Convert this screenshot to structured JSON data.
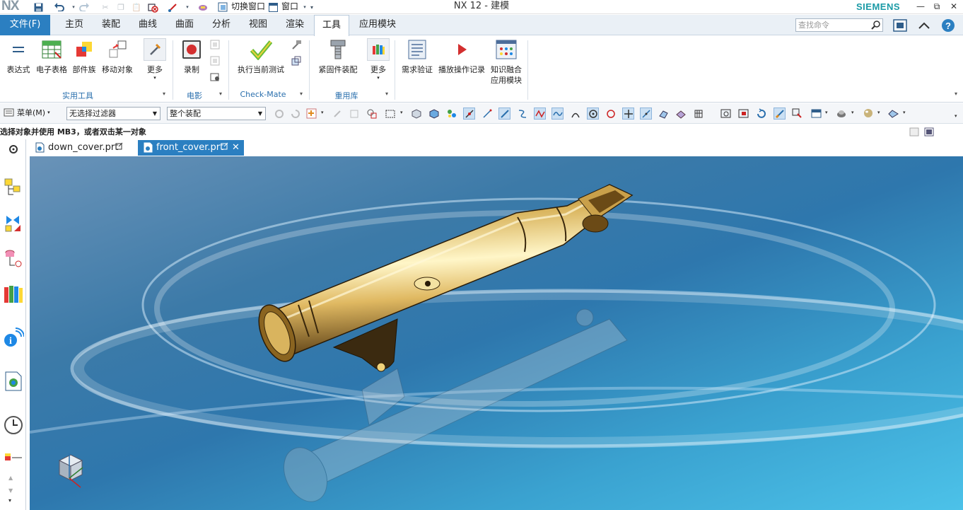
{
  "window": {
    "title": "NX 12 - 建模",
    "logo": "NX",
    "brand": "SIEMENS"
  },
  "quick_access": {
    "switch_window": "切换窗口",
    "window_menu": "窗口"
  },
  "menu_tabs": {
    "file": "文件(F)",
    "tabs": [
      "主页",
      "装配",
      "曲线",
      "曲面",
      "分析",
      "视图",
      "渲染",
      "工具",
      "应用模块"
    ],
    "active": "工具",
    "search_placeholder": "查找命令"
  },
  "ribbon": {
    "groups": [
      {
        "label": "实用工具",
        "buttons": [
          "表达式",
          "电子表格",
          "部件族",
          "移动对象",
          "更多"
        ]
      },
      {
        "label": "电影",
        "buttons": [
          "录制"
        ]
      },
      {
        "label": "Check-Mate",
        "buttons": [
          "执行当前测试"
        ]
      },
      {
        "label": "重用库",
        "buttons": [
          "紧固件装配",
          "更多"
        ]
      },
      {
        "label": "",
        "buttons": [
          "需求验证",
          "播放操作记录",
          "知识融合\n应用模块"
        ]
      }
    ],
    "knowledge_line1": "知识融合",
    "knowledge_line2": "应用模块"
  },
  "toolbar": {
    "menu_label": "菜单(M)",
    "filter_value": "无选择过滤器",
    "scope_value": "整个装配"
  },
  "status": {
    "cue": "选择对象并使用 MB3，或者双击某一对象"
  },
  "doc_tabs": [
    {
      "name": "down_cover.prt",
      "active": false
    },
    {
      "name": "front_cover.prt",
      "active": true
    }
  ],
  "colors": {
    "accent": "#2b7fc1",
    "brand": "#1a9aa6",
    "model": "#d8b25a"
  },
  "icons": [
    "save-icon",
    "undo-icon",
    "redo-icon",
    "cut-icon",
    "copy-icon",
    "paste-icon",
    "help-icon",
    "search-icon",
    "clock-icon",
    "gear-icon",
    "triad-icon"
  ]
}
